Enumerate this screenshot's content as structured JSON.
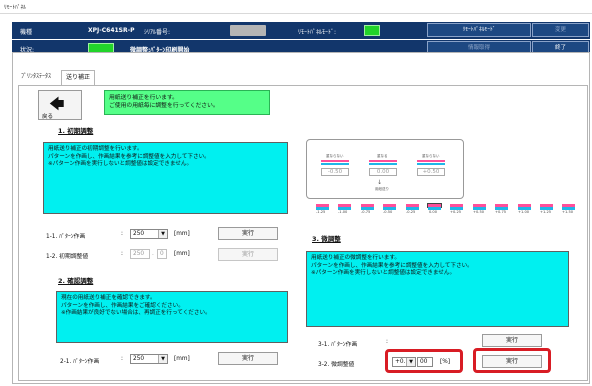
{
  "window": {
    "title": "ﾘﾓｰﾄﾊﾟﾈﾙ"
  },
  "header": {
    "model_label": "機種",
    "model_value": "XPJ-C641SR-P",
    "serial_label": "ｼﾘｱﾙ番号:",
    "remote_mode_label": "ﾘﾓｰﾄﾊﾟﾈﾙﾓｰﾄﾞ:",
    "remote_mode_button": "ﾘﾓｰﾄﾊﾟﾈﾙﾓｰﾄﾞ",
    "change_button": "変更",
    "status_label": "状況:",
    "status_text": "微調整:ﾊﾟﾀｰﾝ印刷開始",
    "cancel_button": "情報取得",
    "exit_button": "終了",
    "indicator_color": "#22d42a"
  },
  "tabs": {
    "status_tab": "ﾌﾟﾘﾝﾀｽﾃｰﾀｽ",
    "feed_tab": "送り補正"
  },
  "back": {
    "label": "戻る",
    "icon": "left-arrow-icon"
  },
  "notice": {
    "line1": "用紙送り補正を行います。",
    "line2": "ご使用の用紙毎に調整を行ってください。"
  },
  "initial": {
    "title": "1. 初期調整",
    "desc": [
      "用紙送り補正の初期調整を行います。",
      "パターンを作画し、作画結果を参考に調整値を入力して下さい。",
      "※パターン作画を実行しないと調整値は設定できません。"
    ],
    "row1_label": "1-1. ﾊﾟﾀｰﾝ作画",
    "row1_value": "250",
    "row1_unit": "[mm]",
    "row1_button": "実行",
    "row2_label": "1-2. 初期調整値",
    "row2_value1": "250",
    "row2_value2": "0",
    "row2_unit": "[mm]",
    "row2_button": "実行",
    "colon": ":"
  },
  "confirm": {
    "title": "2. 確認調整",
    "desc": [
      "現在の用紙送り補正を確認できます。",
      "パターンを作画し、作画結果をご確認ください。",
      "※作画結果が良好でない場合は、再調正を行ってください。"
    ],
    "row_label": "2-1. ﾊﾟﾀｰﾝ作画",
    "row_value": "250",
    "row_unit": "[mm]",
    "row_button": "実行",
    "colon": ":"
  },
  "fine": {
    "title": "3. 微調整",
    "desc": [
      "用紙送り補正の微調整を行います。",
      "パターンを作画し、作画結果を参考に調整値を入力して下さい。",
      "※パターン作画を実行しないと調整値は設定できません。"
    ],
    "row1_label": "3-1. ﾊﾟﾀｰﾝ作画",
    "row1_button": "実行",
    "row2_label": "3-2. 微調整値",
    "row2_sign": "+0.",
    "row2_value": "00",
    "row2_unit": "[%]",
    "row2_button": "実行",
    "colon": ":",
    "highlight_color": "#d81c24"
  },
  "preview": {
    "labels": [
      "重ならない",
      "重なる",
      "重ならない"
    ],
    "values": [
      "-0.50",
      "0.00",
      "+0.50"
    ],
    "center_label": "用紙送り",
    "scale": [
      "-1.00",
      "-0.75",
      "-0.50",
      "-0.25",
      "0.00",
      "+0.25",
      "+0.50",
      "+0.75",
      "+1.00",
      "+1.25",
      "+1.50"
    ],
    "scale_left": "-1.25",
    "pink": "#ff4f9a",
    "cyan": "#1fb6e8"
  }
}
